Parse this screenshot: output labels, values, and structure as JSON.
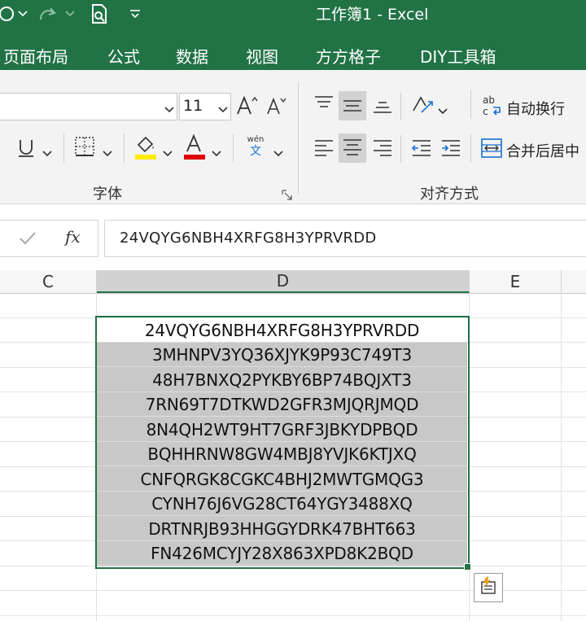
{
  "window": {
    "title": "工作簿1  -  Excel"
  },
  "menu_tabs": [
    {
      "label": "页面布局"
    },
    {
      "label": "公式"
    },
    {
      "label": "数据"
    },
    {
      "label": "视图"
    },
    {
      "label": "方方格子"
    },
    {
      "label": "DIY工具箱"
    }
  ],
  "ribbon": {
    "font_size_value": "11",
    "font_group_label": "字体",
    "align_group_label": "对齐方式",
    "wrap_text_label": "自动换行",
    "merge_center_label": "合并后居中",
    "phonetic_top": "wén",
    "phonetic_bottom": "文"
  },
  "formula_bar": {
    "fx_label": "fx",
    "content": "24VQYG6NBH4XRFG8H3YPRVRDD"
  },
  "columns": [
    {
      "label": "C"
    },
    {
      "label": "D"
    },
    {
      "label": "E"
    }
  ],
  "cells_D": [
    "24VQYG6NBH4XRFG8H3YPRVRDD",
    "3MHNPV3YQ36XJYK9P93C749T3",
    "48H7BNXQ2PYKBY6BP74BQJXT3",
    "7RN69T7DTKWD2GFR3MJQRJMQD",
    "8N4QH2WT9HT7GRF3JBKYDPBQD",
    "BQHHRNW8GW4MBJ8YVJK6KTJXQ",
    "CNFQRGK8CGKC4BHJ2MWTGMQG3",
    "CYNH76J6VG28CT64YGY3488XQ",
    "DRTNRJB93HHGGYDRK47BHT663",
    "FN426MCYJY28X863XPD8K2BQD"
  ],
  "colors": {
    "excel_green": "#217346",
    "highlight_yellow": "#ffeb00",
    "font_red": "#e00000"
  }
}
